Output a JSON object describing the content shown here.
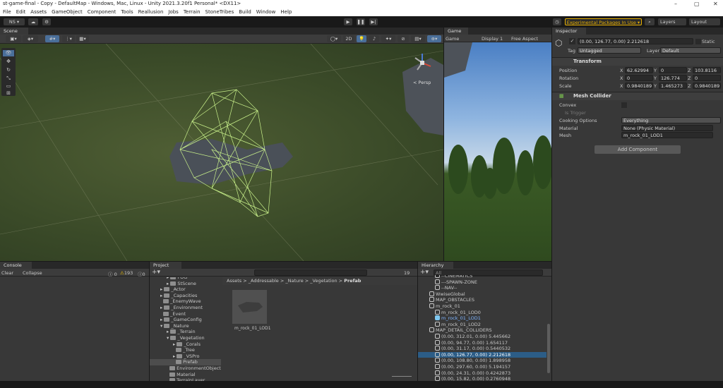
{
  "window": {
    "title": "st-game-final - Copy - DefaultMap - Windows, Mac, Linux - Unity 2021.3.20f1 Personal* <DX11>",
    "min": "–",
    "max": "▢",
    "close": "✕"
  },
  "menu": [
    "File",
    "Edit",
    "Assets",
    "GameObject",
    "Component",
    "Tools",
    "Reallusion",
    "Jobs",
    "Terrain",
    "StoneTribes",
    "Build",
    "Window",
    "Help"
  ],
  "toolbar": {
    "account": "NS ▾",
    "experimental": "Experimental Packages In Use ▾",
    "layers": "Layers",
    "layout": "Layout"
  },
  "scene": {
    "tab": "Scene",
    "mode_2d": "2D",
    "persp": "< Persp"
  },
  "game": {
    "tab": "Game",
    "mode": "Game",
    "display": "Display 1",
    "aspect": "Free Aspect"
  },
  "inspector": {
    "tab": "Inspector",
    "object_name": "(0.00, 126.77, 0.00) 2.212618",
    "static": "Static",
    "tag_label": "Tag",
    "tag": "Untagged",
    "layer_label": "Layer",
    "layer": "Default",
    "transform": {
      "title": "Transform",
      "rows": [
        {
          "label": "Position",
          "x": "62.62994",
          "y": "0",
          "z": "103.8116"
        },
        {
          "label": "Rotation",
          "x": "0",
          "y": "126.774",
          "z": "0"
        },
        {
          "label": "Scale",
          "x": "0.9840189",
          "y": "1.465273",
          "z": "0.9840189"
        }
      ]
    },
    "mesh_collider": {
      "title": "Mesh Collider",
      "convex": "Convex",
      "is_trigger": "Is Trigger",
      "cooking_label": "Cooking Options",
      "cooking": "Everything",
      "material_label": "Material",
      "material": "None (Physic Material)",
      "mesh_label": "Mesh",
      "mesh": "m_rock_01_LOD1"
    },
    "add_component": "Add Component"
  },
  "console": {
    "tab": "Console",
    "clear": "Clear",
    "collapse": "Collapse",
    "errors": "0",
    "warnings": "193",
    "messages": "0"
  },
  "project": {
    "tab": "Project",
    "breadcrumb": [
      "Assets",
      "_Addressable",
      "_Nature",
      "_Vegetation",
      "Prefab"
    ],
    "hidden_count": "19",
    "tree": [
      {
        "label": "FOG",
        "indent": 2,
        "arrow": true
      },
      {
        "label": "StScene",
        "indent": 2,
        "arrow": true
      },
      {
        "label": "_Actor",
        "indent": 1,
        "arrow": true
      },
      {
        "label": "_Capacities",
        "indent": 1,
        "arrow": true
      },
      {
        "label": "_EnemyWave",
        "indent": 1,
        "arrow": false
      },
      {
        "label": "_Environment",
        "indent": 1,
        "arrow": true
      },
      {
        "label": "_Event",
        "indent": 1,
        "arrow": false
      },
      {
        "label": "_GameConfig",
        "indent": 1,
        "arrow": true
      },
      {
        "label": "_Nature",
        "indent": 1,
        "arrow": "open"
      },
      {
        "label": "_Terrain",
        "indent": 2,
        "arrow": true
      },
      {
        "label": "_Vegetation",
        "indent": 2,
        "arrow": "open"
      },
      {
        "label": "_Corals",
        "indent": 3,
        "arrow": true
      },
      {
        "label": "_Tree",
        "indent": 3,
        "arrow": false
      },
      {
        "label": "_VSPro",
        "indent": 3,
        "arrow": true
      },
      {
        "label": "Prefab",
        "indent": 3,
        "arrow": false,
        "selected": true
      },
      {
        "label": "EnvironmentObject",
        "indent": 2,
        "arrow": false
      },
      {
        "label": "Material",
        "indent": 2,
        "arrow": false
      },
      {
        "label": "TerrainLayer",
        "indent": 2,
        "arrow": false
      }
    ],
    "asset": "m_rock_01_LOD1"
  },
  "hierarchy": {
    "tab": "Hierarchy",
    "search_placeholder": "All",
    "items": [
      {
        "label": "--CINEMATICS",
        "indent": 2
      },
      {
        "label": "---SPAWN-ZONE",
        "indent": 2
      },
      {
        "label": "--NAV--",
        "indent": 2
      },
      {
        "label": "WwiseGlobal",
        "indent": 1
      },
      {
        "label": "MAP_OBSTACLES",
        "indent": 1
      },
      {
        "label": "m_rock_01",
        "indent": 1
      },
      {
        "label": "m_rock_01_LOD0",
        "indent": 2
      },
      {
        "label": "m_rock_01_LOD1",
        "indent": 2,
        "highlight": true
      },
      {
        "label": "m_rock_01_LOD2",
        "indent": 2
      },
      {
        "label": "MAP_DETAIL_COLLIDERS",
        "indent": 1
      },
      {
        "label": "(0.00, 312.01, 0.00) 5.445662",
        "indent": 2
      },
      {
        "label": "(0.00, 94.77, 0.00) 1.654117",
        "indent": 2
      },
      {
        "label": "(0.00, 31.17, 0.00) 0.5440532",
        "indent": 2
      },
      {
        "label": "(0.00, 126.77, 0.00) 2.212618",
        "indent": 2,
        "selected": true
      },
      {
        "label": "(0.00, 108.80, 0.00) 1.898958",
        "indent": 2
      },
      {
        "label": "(0.00, 297.60, 0.00) 5.194157",
        "indent": 2
      },
      {
        "label": "(0.00, 24.31, 0.00) 0.4242873",
        "indent": 2
      },
      {
        "label": "(0.00, 15.82, 0.00) 0.2760948",
        "indent": 2
      }
    ]
  },
  "colors": {
    "accent": "#2c5d87",
    "experimental": "#e8b000",
    "wireframe": "#c8f08a"
  }
}
